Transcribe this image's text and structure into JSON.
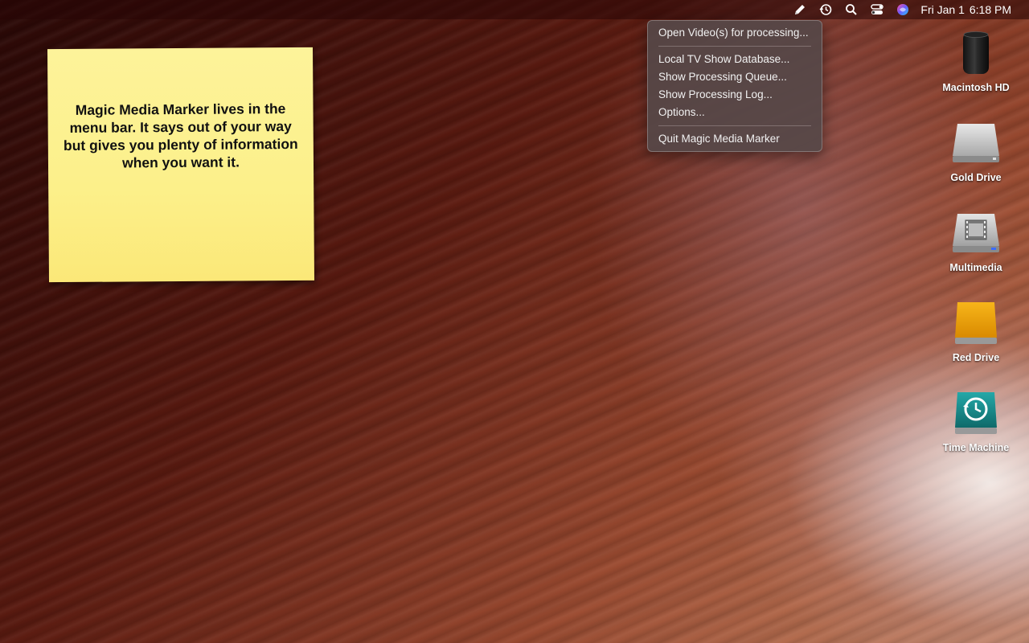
{
  "menubar": {
    "icons": [
      "pencil-icon",
      "history-icon",
      "search-icon",
      "control-center-icon",
      "siri-icon"
    ],
    "date": "Fri Jan 1",
    "time": "6:18 PM"
  },
  "menu": {
    "items": [
      "Open Video(s) for processing...",
      "Local TV Show Database...",
      "Show Processing Queue...",
      "Show Processing Log...",
      "Options...",
      "Quit Magic Media Marker"
    ]
  },
  "sticky": {
    "text": "Magic Media Marker lives in the menu bar. It says out of your way but gives you plenty of information when you want it."
  },
  "desktop": {
    "icons": [
      {
        "label": "Macintosh HD",
        "icon": "mac-pro-icon"
      },
      {
        "label": "Gold Drive",
        "icon": "silver-drive-icon"
      },
      {
        "label": "Multimedia",
        "icon": "multimedia-drive-icon"
      },
      {
        "label": "Red Drive",
        "icon": "gold-drive-icon"
      },
      {
        "label": "Time Machine",
        "icon": "time-machine-icon"
      }
    ]
  },
  "colors": {
    "menu_bg": "#564848",
    "sticky": "#fcf08a",
    "time_machine": "#1a8a8a"
  }
}
